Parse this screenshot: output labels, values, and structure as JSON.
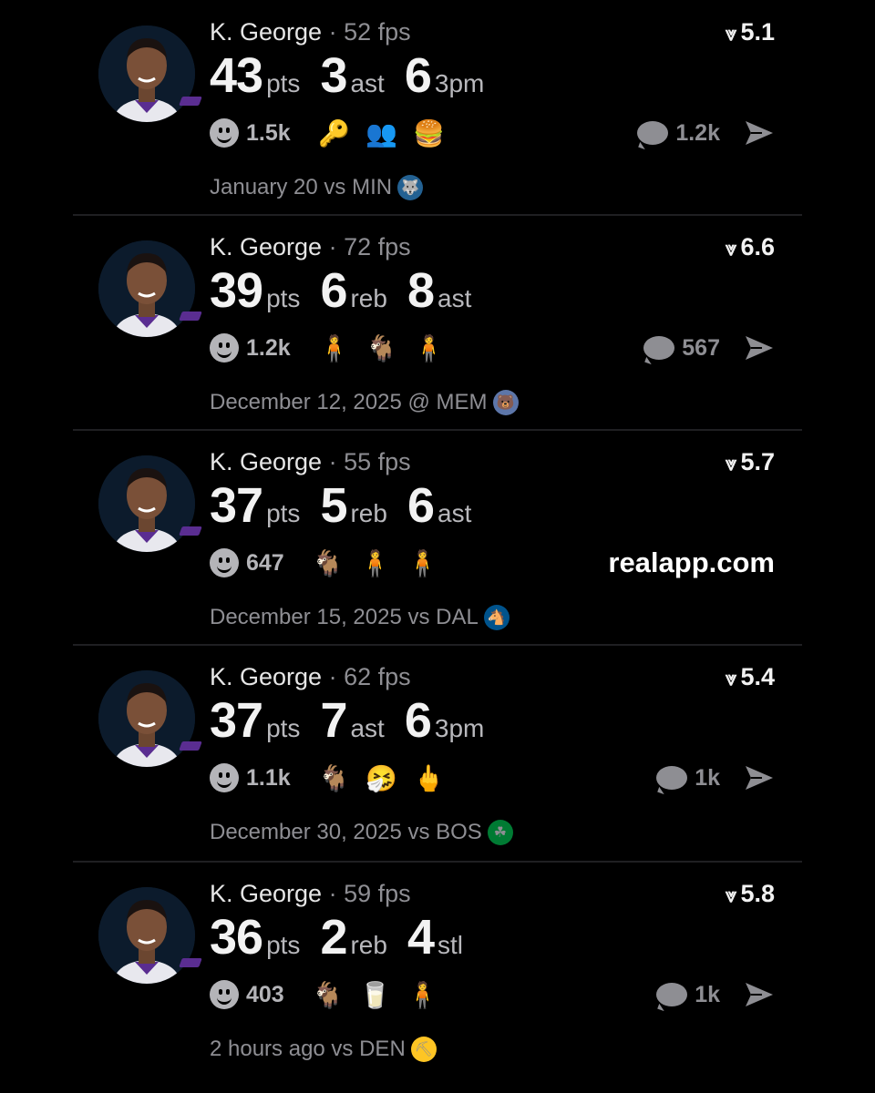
{
  "colors": {
    "background": "#000000",
    "text_primary": "#f2f2f2",
    "text_muted": "#8e8e93",
    "divider": "#1f1f22",
    "badge": "#5a2d91"
  },
  "cards": [
    {
      "player": "K. George",
      "fps": "· 52 fps",
      "rating": "5.1",
      "stats": [
        {
          "num": "43",
          "label": "pts"
        },
        {
          "num": "3",
          "label": "ast"
        },
        {
          "num": "6",
          "label": "3pm"
        }
      ],
      "reactions": "1.5k",
      "emojis": [
        "🔑",
        "👥",
        "🍔"
      ],
      "comments": "1.2k",
      "date": "January 20 vs MIN",
      "team_icon": "timberwolves-logo-icon"
    },
    {
      "player": "K. George",
      "fps": "· 72 fps",
      "rating": "6.6",
      "stats": [
        {
          "num": "39",
          "label": "pts"
        },
        {
          "num": "6",
          "label": "reb"
        },
        {
          "num": "8",
          "label": "ast"
        }
      ],
      "reactions": "1.2k",
      "emojis": [
        "🧍",
        "🐐",
        "🧍"
      ],
      "comments": "567",
      "date": "December 12, 2025 @ MEM",
      "team_icon": "grizzlies-logo-icon"
    },
    {
      "player": "K. George",
      "fps": "· 55 fps",
      "rating": "5.7",
      "stats": [
        {
          "num": "37",
          "label": "pts"
        },
        {
          "num": "5",
          "label": "reb"
        },
        {
          "num": "6",
          "label": "ast"
        }
      ],
      "reactions": "647",
      "emojis": [
        "🐐",
        "🧍",
        "🧍"
      ],
      "watermark": "realapp.com",
      "date": "December 15, 2025 vs DAL",
      "team_icon": "mavericks-logo-icon"
    },
    {
      "player": "K. George",
      "fps": "· 62 fps",
      "rating": "5.4",
      "stats": [
        {
          "num": "37",
          "label": "pts"
        },
        {
          "num": "7",
          "label": "ast"
        },
        {
          "num": "6",
          "label": "3pm"
        }
      ],
      "reactions": "1.1k",
      "emojis": [
        "🐐",
        "🤧",
        "🖕"
      ],
      "comments": "1k",
      "date": "December 30, 2025 vs BOS",
      "team_icon": "celtics-logo-icon"
    },
    {
      "player": "K. George",
      "fps": "· 59 fps",
      "rating": "5.8",
      "stats": [
        {
          "num": "36",
          "label": "pts"
        },
        {
          "num": "2",
          "label": "reb"
        },
        {
          "num": "4",
          "label": "stl"
        }
      ],
      "reactions": "403",
      "emojis": [
        "🐐",
        "🥛",
        "🧍"
      ],
      "comments": "1k",
      "date": "2 hours ago vs DEN",
      "team_icon": "nuggets-logo-icon"
    }
  ]
}
